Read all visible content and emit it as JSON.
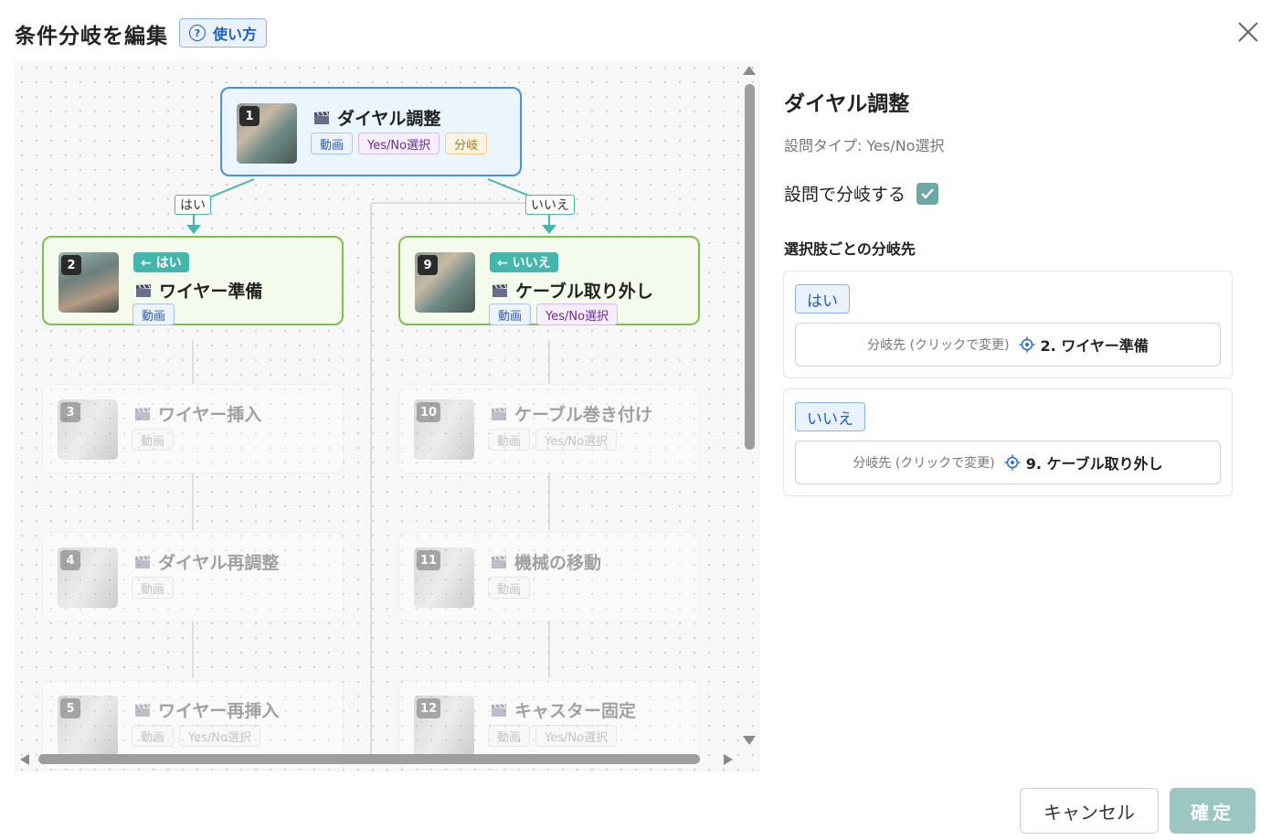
{
  "header": {
    "title": "条件分岐を編集",
    "help_label": "使い方"
  },
  "flow": {
    "edge_labels": {
      "yes": "はい",
      "no": "いいえ"
    },
    "nodes": [
      {
        "num": "1",
        "title": "ダイヤル調整",
        "tags": [
          "動画",
          "Yes/No選択",
          "分岐"
        ]
      },
      {
        "num": "2",
        "title": "ワイヤー準備",
        "from": "← はい",
        "tags": [
          "動画"
        ]
      },
      {
        "num": "9",
        "title": "ケーブル取り外し",
        "from": "← いいえ",
        "tags": [
          "動画",
          "Yes/No選択"
        ]
      },
      {
        "num": "3",
        "title": "ワイヤー挿入",
        "tags": [
          "動画"
        ]
      },
      {
        "num": "10",
        "title": "ケーブル巻き付け",
        "tags": [
          "動画",
          "Yes/No選択"
        ]
      },
      {
        "num": "4",
        "title": "ダイヤル再調整",
        "tags": [
          "動画"
        ]
      },
      {
        "num": "11",
        "title": "機械の移動",
        "tags": [
          "動画"
        ]
      },
      {
        "num": "5",
        "title": "ワイヤー再挿入",
        "tags": [
          "動画",
          "Yes/No選択"
        ]
      },
      {
        "num": "12",
        "title": "キャスター固定",
        "tags": [
          "動画",
          "Yes/No選択"
        ]
      }
    ]
  },
  "panel": {
    "title": "ダイヤル調整",
    "question_type": "設問タイプ: Yes/No選択",
    "branch_toggle_label": "設問で分岐する",
    "branch_enabled": true,
    "section_title": "選択肢ごとの分岐先",
    "options": [
      {
        "label": "はい",
        "hint": "分岐先 (クリックで変更)",
        "target": "2. ワイヤー準備"
      },
      {
        "label": "いいえ",
        "hint": "分岐先 (クリックで変更)",
        "target": "9. ケーブル取り外し"
      }
    ]
  },
  "footer": {
    "cancel_label": "キャンセル",
    "confirm_label": "確定"
  },
  "colors": {
    "accent": "#4a8fe7",
    "branch": "#7cc24b",
    "teal": "#46b6ad",
    "confirm": "#9cc6c2"
  }
}
